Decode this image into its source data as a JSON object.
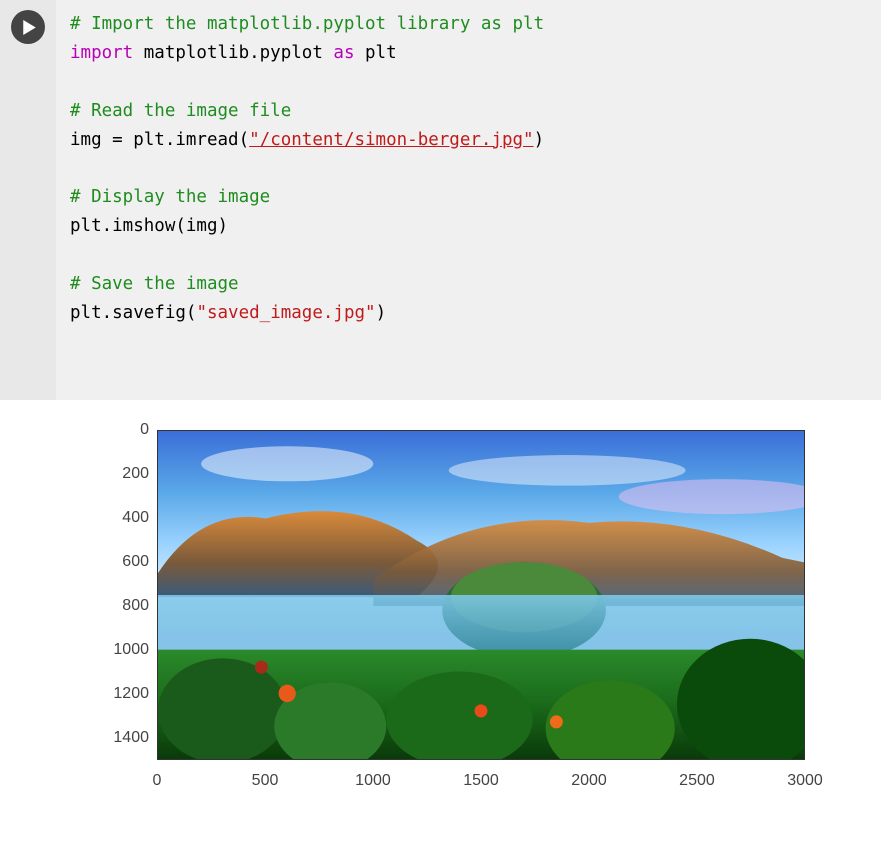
{
  "chart_data": {
    "type": "image",
    "xlim": [
      0,
      3000
    ],
    "ylim": [
      0,
      1500
    ],
    "y_inverted": true,
    "x_ticks": [
      0,
      500,
      1000,
      1500,
      2000,
      2500,
      3000
    ],
    "y_ticks": [
      0,
      200,
      400,
      600,
      800,
      1000,
      1200,
      1400
    ],
    "description": "Vivid landscape photo (mountains, hazy valley, tropical vegetation under blue sky) displayed via plt.imshow with pixel-coordinate axes."
  },
  "code": {
    "c1": "# Import the matplotlib.pyplot library as plt",
    "kw_import": "import",
    "mod": " matplotlib.pyplot ",
    "kw_as": "as",
    "alias": " plt",
    "c2": "# Read the image file",
    "l3a": "img = plt.imread(",
    "l3s": "\"/content/simon-berger.jpg\"",
    "l3b": ")",
    "c3": "# Display the image",
    "l5": "plt.imshow(img)",
    "c4": "# Save the image",
    "l7a": "plt.savefig(",
    "l7s": "\"saved_image.jpg\"",
    "l7b": ")"
  },
  "yticks": {
    "t0": "0",
    "t1": "200",
    "t2": "400",
    "t3": "600",
    "t4": "800",
    "t5": "1000",
    "t6": "1200",
    "t7": "1400"
  },
  "xticks": {
    "t0": "0",
    "t1": "500",
    "t2": "1000",
    "t3": "1500",
    "t4": "2000",
    "t5": "2500",
    "t6": "3000"
  }
}
